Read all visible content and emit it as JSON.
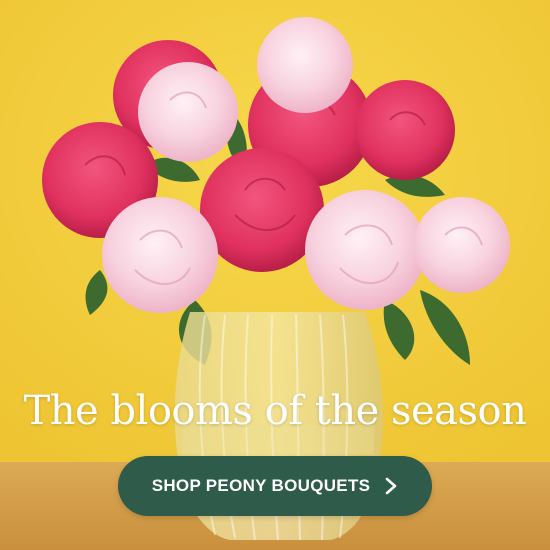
{
  "headline": "The blooms of the season",
  "cta": {
    "label": "SHOP PEONY BOUQUETS",
    "icon": "chevron-right-icon"
  },
  "colors": {
    "background": "#f2cf3a",
    "table": "#d6a24f",
    "button": "#2f5b4a",
    "text": "#ffffff",
    "peony_magenta": "#e0315f",
    "peony_pink": "#f6c6d6"
  }
}
